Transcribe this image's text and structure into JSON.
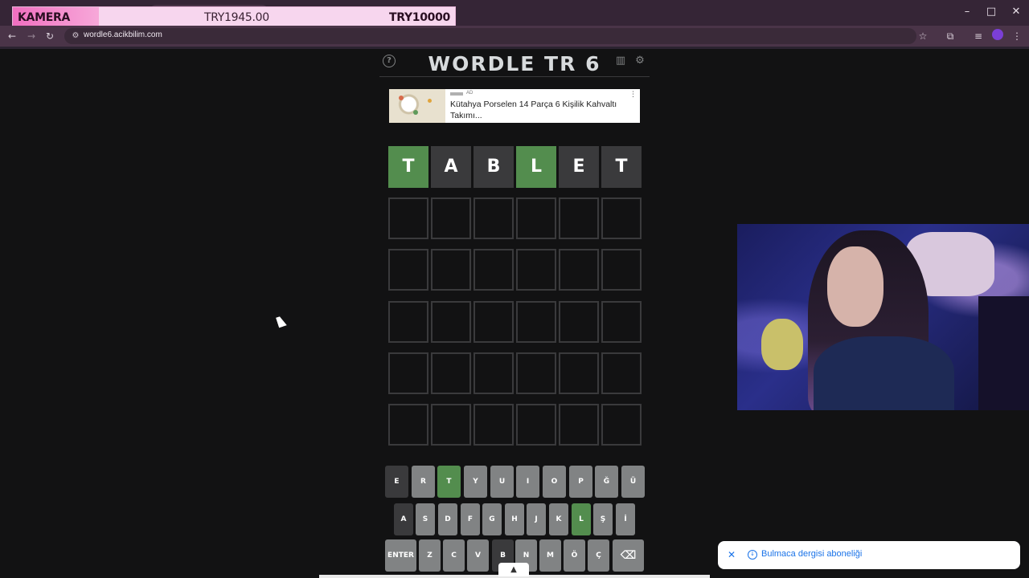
{
  "overlay": {
    "label": "KAMERA",
    "amount": "TRY1945.00",
    "goal": "TRY10000"
  },
  "browser": {
    "url": "wordle6.acikbilim.com",
    "window_controls": [
      "–",
      "□",
      "✕"
    ]
  },
  "game": {
    "title": "WORDLE TR 6",
    "board": [
      [
        {
          "letter": "T",
          "state": "correct"
        },
        {
          "letter": "A",
          "state": "absent"
        },
        {
          "letter": "B",
          "state": "absent"
        },
        {
          "letter": "L",
          "state": "correct"
        },
        {
          "letter": "E",
          "state": "absent"
        },
        {
          "letter": "T",
          "state": "absent"
        }
      ],
      [
        {
          "letter": "",
          "state": "empty"
        },
        {
          "letter": "",
          "state": "empty"
        },
        {
          "letter": "",
          "state": "empty"
        },
        {
          "letter": "",
          "state": "empty"
        },
        {
          "letter": "",
          "state": "empty"
        },
        {
          "letter": "",
          "state": "empty"
        }
      ],
      [
        {
          "letter": "",
          "state": "empty"
        },
        {
          "letter": "",
          "state": "empty"
        },
        {
          "letter": "",
          "state": "empty"
        },
        {
          "letter": "",
          "state": "empty"
        },
        {
          "letter": "",
          "state": "empty"
        },
        {
          "letter": "",
          "state": "empty"
        }
      ],
      [
        {
          "letter": "",
          "state": "empty"
        },
        {
          "letter": "",
          "state": "empty"
        },
        {
          "letter": "",
          "state": "empty"
        },
        {
          "letter": "",
          "state": "empty"
        },
        {
          "letter": "",
          "state": "empty"
        },
        {
          "letter": "",
          "state": "empty"
        }
      ],
      [
        {
          "letter": "",
          "state": "empty"
        },
        {
          "letter": "",
          "state": "empty"
        },
        {
          "letter": "",
          "state": "empty"
        },
        {
          "letter": "",
          "state": "empty"
        },
        {
          "letter": "",
          "state": "empty"
        },
        {
          "letter": "",
          "state": "empty"
        }
      ],
      [
        {
          "letter": "",
          "state": "empty"
        },
        {
          "letter": "",
          "state": "empty"
        },
        {
          "letter": "",
          "state": "empty"
        },
        {
          "letter": "",
          "state": "empty"
        },
        {
          "letter": "",
          "state": "empty"
        },
        {
          "letter": "",
          "state": "empty"
        }
      ]
    ],
    "keyboard": [
      [
        {
          "label": "E",
          "state": "absent"
        },
        {
          "label": "R",
          "state": "unused"
        },
        {
          "label": "T",
          "state": "correct"
        },
        {
          "label": "Y",
          "state": "unused"
        },
        {
          "label": "U",
          "state": "unused"
        },
        {
          "label": "I",
          "state": "unused"
        },
        {
          "label": "O",
          "state": "unused"
        },
        {
          "label": "P",
          "state": "unused"
        },
        {
          "label": "Ğ",
          "state": "unused"
        },
        {
          "label": "Ü",
          "state": "unused"
        }
      ],
      [
        {
          "label": "A",
          "state": "absent"
        },
        {
          "label": "S",
          "state": "unused"
        },
        {
          "label": "D",
          "state": "unused"
        },
        {
          "label": "F",
          "state": "unused"
        },
        {
          "label": "G",
          "state": "unused"
        },
        {
          "label": "H",
          "state": "unused"
        },
        {
          "label": "J",
          "state": "unused"
        },
        {
          "label": "K",
          "state": "unused"
        },
        {
          "label": "L",
          "state": "correct"
        },
        {
          "label": "Ş",
          "state": "unused"
        },
        {
          "label": "İ",
          "state": "unused"
        }
      ],
      [
        {
          "label": "ENTER",
          "state": "unused"
        },
        {
          "label": "Z",
          "state": "unused"
        },
        {
          "label": "C",
          "state": "unused"
        },
        {
          "label": "V",
          "state": "unused"
        },
        {
          "label": "B",
          "state": "absent"
        },
        {
          "label": "N",
          "state": "unused"
        },
        {
          "label": "M",
          "state": "unused"
        },
        {
          "label": "Ö",
          "state": "unused"
        },
        {
          "label": "Ç",
          "state": "unused"
        },
        {
          "label": "⌫",
          "state": "unused"
        }
      ]
    ]
  },
  "ad": {
    "tag": "AD",
    "text": "Kütahya Porselen 14 Parça 6 Kişilik Kahvaltı Takımı..."
  },
  "toast": {
    "text": "Bulmaca dergisi aboneliği"
  },
  "colors": {
    "correct": "#538d4e",
    "absent": "#3a3a3c",
    "unused": "#818384",
    "background": "#121213"
  }
}
